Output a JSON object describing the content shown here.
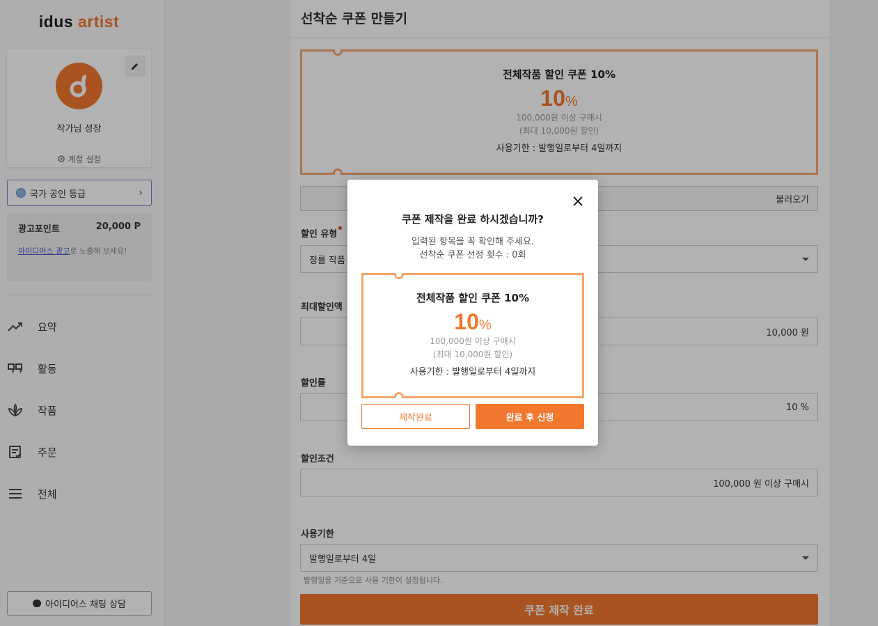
{
  "sidebar": {
    "logo_prefix": "idus",
    "logo_suffix": "artist",
    "profile_name": "작가님 성장",
    "account_settings": "계정 설정",
    "grade_label": "국가 공인 등급",
    "ad_points_label": "광고포인트",
    "ad_points_value": "20,000 P",
    "ad_link": "아이디어스 광고",
    "ad_text_rest": "로 노출해 보세요!",
    "nav": [
      {
        "label": "요약",
        "icon": "trend-icon"
      },
      {
        "label": "활동",
        "icon": "quote-icon"
      },
      {
        "label": "작품",
        "icon": "plant-icon"
      },
      {
        "label": "주문",
        "icon": "order-list-icon"
      },
      {
        "label": "전체",
        "icon": "menu-icon"
      }
    ],
    "chat_button": "아이디어스 채팅 상담"
  },
  "main": {
    "title": "선착순 쿠폰 만들기",
    "coupon_preview": {
      "title": "전체작품 할인 쿠폰 10%",
      "percent": "10",
      "percent_sign": "%",
      "condition": "100,000원 이상 구매시",
      "max_discount": "(최대 10,000원 할인)",
      "validity": "사용기한 : 발행일로부터 4일까지"
    },
    "load_button_tail": "불러오기",
    "discount_type_label": "할인 유형",
    "discount_type_value": "정률 작품",
    "max_discount_label": "최대할인액",
    "max_discount_value": "10,000 원",
    "rate_label": "할인률",
    "rate_value": "10 %",
    "condition_label": "할인조건",
    "condition_value": "100,000 원 이상 구매시",
    "validity_label": "사용기한",
    "validity_value": "발행일로부터 4일",
    "validity_helper": "발행일을 기준으로 사용 기한이 설정됩니다.",
    "submit_label": "쿠폰 제작 완료"
  },
  "modal": {
    "title": "쿠폰 제작을 완료 하시겠습니까?",
    "sub_line1": "입력된 항목을 꼭 확인해 주세요.",
    "sub_line2": "선착순 쿠폰 선정 횟수 : 0회",
    "coupon": {
      "title": "전체작품 할인 쿠폰 10%",
      "percent": "10",
      "percent_sign": "%",
      "condition": "100,000원 이상 구매시",
      "max_discount": "(최대 10,000원 할인)",
      "validity": "사용기한 : 발행일로부터 4일까지"
    },
    "btn_complete": "제작완료",
    "btn_complete_apply": "완료 후 신청"
  },
  "colors": {
    "accent": "#f1782e",
    "ticket_border": "#f6a66c"
  }
}
